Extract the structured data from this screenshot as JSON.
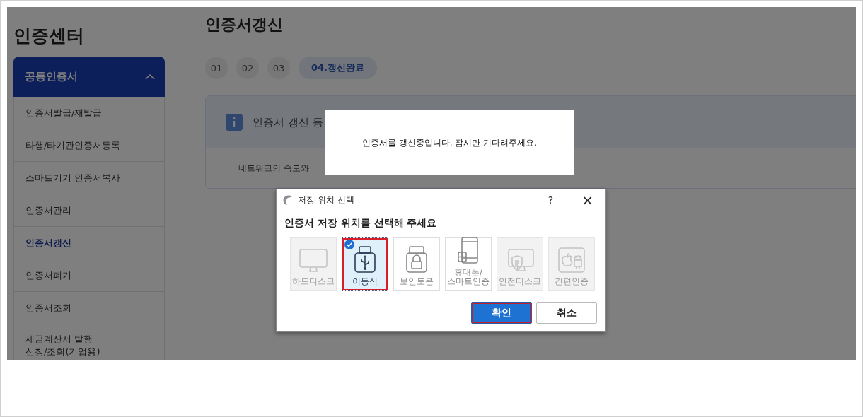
{
  "sidebar": {
    "title": "인증센터",
    "group": {
      "label": "공동인증서",
      "expanded": true
    },
    "items": [
      {
        "label": "인증서발급/재발급",
        "selected": false
      },
      {
        "label": "타행/타기관인증서등록",
        "selected": false
      },
      {
        "label": "스마트기기 인증서복사",
        "selected": false
      },
      {
        "label": "인증서관리",
        "selected": false
      },
      {
        "label": "인증서갱신",
        "selected": true
      },
      {
        "label": "인증서폐기",
        "selected": false
      },
      {
        "label": "인증서조회",
        "selected": false
      },
      {
        "label": "세금계산서 발행\n신청/조회(기업용)",
        "selected": false
      }
    ]
  },
  "main": {
    "title": "인증서갱신",
    "steps": [
      {
        "label": "01",
        "selected": false
      },
      {
        "label": "02",
        "selected": false
      },
      {
        "label": "03",
        "selected": false
      },
      {
        "label": "04.갱신완료",
        "selected": true
      }
    ],
    "info": {
      "heading": "인증서 갱신 등",
      "text": "네트워크의 속도와"
    }
  },
  "overlay": {
    "shown": true
  },
  "loading": {
    "message": "인증서를 갱신중입니다. 잠시만 기다려주세요."
  },
  "dialog": {
    "title": "저장 위치 선택",
    "help": "?",
    "close": "×",
    "heading": "인증서 저장 위치를 선택해 주세요",
    "tiles": [
      {
        "kind": "monitor",
        "label": "하드디스크",
        "disabled": true,
        "selected": false,
        "highlighted": false
      },
      {
        "kind": "usb",
        "label": "이동식",
        "disabled": false,
        "selected": true,
        "highlighted": true
      },
      {
        "kind": "lock",
        "label": "보안토큰",
        "disabled": false,
        "selected": false,
        "highlighted": false
      },
      {
        "kind": "phone",
        "label": "휴대폰/\n스마트인증",
        "disabled": false,
        "selected": false,
        "highlighted": false
      },
      {
        "kind": "secure-disk",
        "label": "안전디스크",
        "disabled": true,
        "selected": false,
        "highlighted": false
      },
      {
        "kind": "easy-auth",
        "label": "간편인증",
        "disabled": true,
        "selected": false,
        "highlighted": false
      }
    ],
    "buttons": [
      {
        "label": "확인",
        "kind": "primary",
        "highlighted": true
      },
      {
        "label": "취소",
        "kind": "secondary",
        "highlighted": false
      }
    ]
  }
}
